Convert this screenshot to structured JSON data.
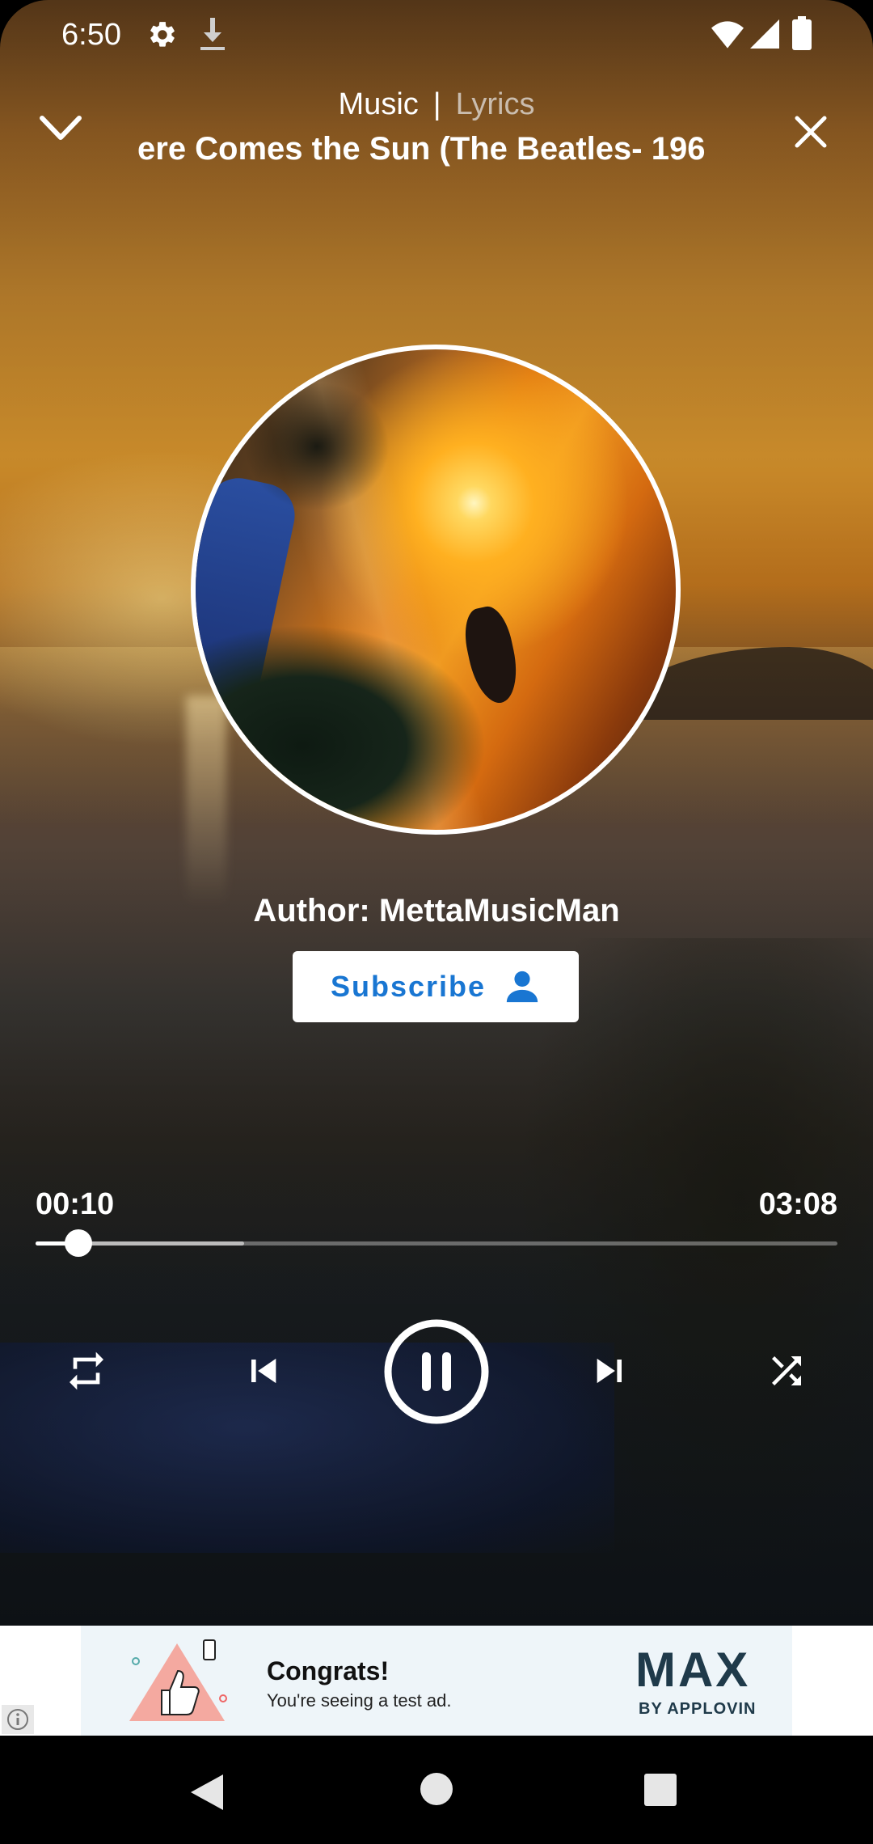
{
  "status_bar": {
    "time": "6:50",
    "icons": [
      "settings-icon",
      "download-icon",
      "wifi-icon",
      "signal-icon",
      "battery-icon"
    ]
  },
  "header": {
    "tab_music": "Music",
    "separator": "|",
    "tab_lyrics": "Lyrics",
    "song_title": "ere Comes the Sun (The Beatles- 196",
    "collapse_icon": "chevron-down-icon",
    "close_icon": "close-icon"
  },
  "author": {
    "label": "Author: MettaMusicMan",
    "subscribe_label": "Subscribe",
    "subscribe_icon": "person-icon"
  },
  "player": {
    "elapsed": "00:10",
    "total": "03:08",
    "progress_fraction": 0.053,
    "buffered_fraction": 0.26,
    "controls": [
      "repeat-icon",
      "skip-previous-icon",
      "pause-icon",
      "skip-next-icon",
      "shuffle-icon"
    ]
  },
  "ad": {
    "title": "Congrats!",
    "subtitle": "You're seeing a test ad.",
    "logo_main": "MAX",
    "logo_sub": "BY APPLOVIN",
    "info_icon": "info-icon"
  },
  "nav": {
    "icons": [
      "back-icon",
      "home-icon",
      "recents-icon"
    ]
  },
  "colors": {
    "accent": "#1976d2",
    "text": "#ffffff"
  }
}
